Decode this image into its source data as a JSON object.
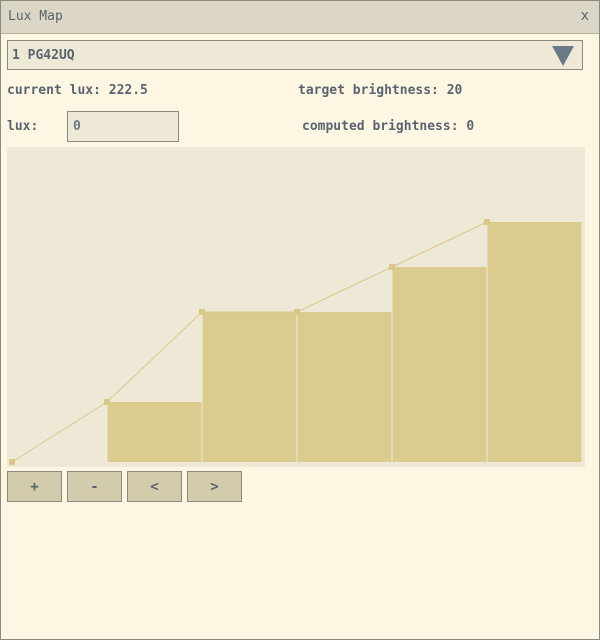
{
  "window": {
    "title": "Lux Map",
    "close_label": "x"
  },
  "display_select": {
    "value": "1 PG42UQ"
  },
  "readouts": {
    "current_lux_label": "current lux: 222.5",
    "target_brightness_label": "target brightness: 20",
    "lux_label": "lux:",
    "lux_input_value": "0",
    "computed_brightness_label": "computed brightness: 0"
  },
  "chart_data": {
    "type": "area",
    "points": [
      0,
      20,
      50,
      50,
      65,
      80
    ],
    "xlim": [
      0,
      6
    ],
    "ylim": [
      0,
      100
    ],
    "grid": false,
    "fill_color": "#dccb8e",
    "line_color": "#d9c78a",
    "background": "#eee8d6"
  },
  "buttons": {
    "add": "+",
    "remove": "-",
    "prev": "<",
    "next": ">"
  },
  "colors": {
    "background": "#fdf6e3",
    "titlebar": "#dcd6c6",
    "text": "#5a6470",
    "button": "#d2cbac"
  }
}
